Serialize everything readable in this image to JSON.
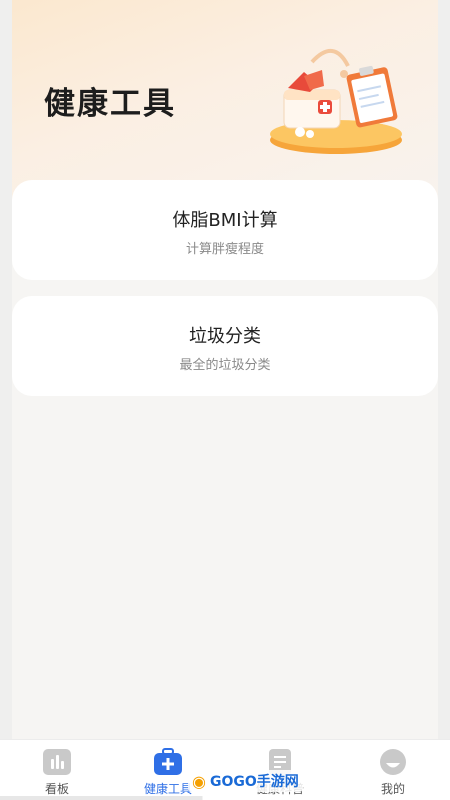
{
  "header": {
    "title": "健康工具"
  },
  "tools": [
    {
      "title": "体脂BMI计算",
      "subtitle": "计算胖瘦程度"
    },
    {
      "title": "垃圾分类",
      "subtitle": "最全的垃圾分类"
    }
  ],
  "tabbar": {
    "items": [
      {
        "label": "看板",
        "icon": "bar-chart-icon"
      },
      {
        "label": "健康工具",
        "icon": "medical-kit-icon",
        "active": true
      },
      {
        "label": "健康科普",
        "icon": "document-icon"
      },
      {
        "label": "我的",
        "icon": "profile-icon"
      }
    ]
  },
  "watermark": {
    "text": "GOGO手游网"
  },
  "colors": {
    "accent": "#2f6fe6",
    "header_gradient_start": "#fbe8cf",
    "card_bg": "#ffffff"
  }
}
